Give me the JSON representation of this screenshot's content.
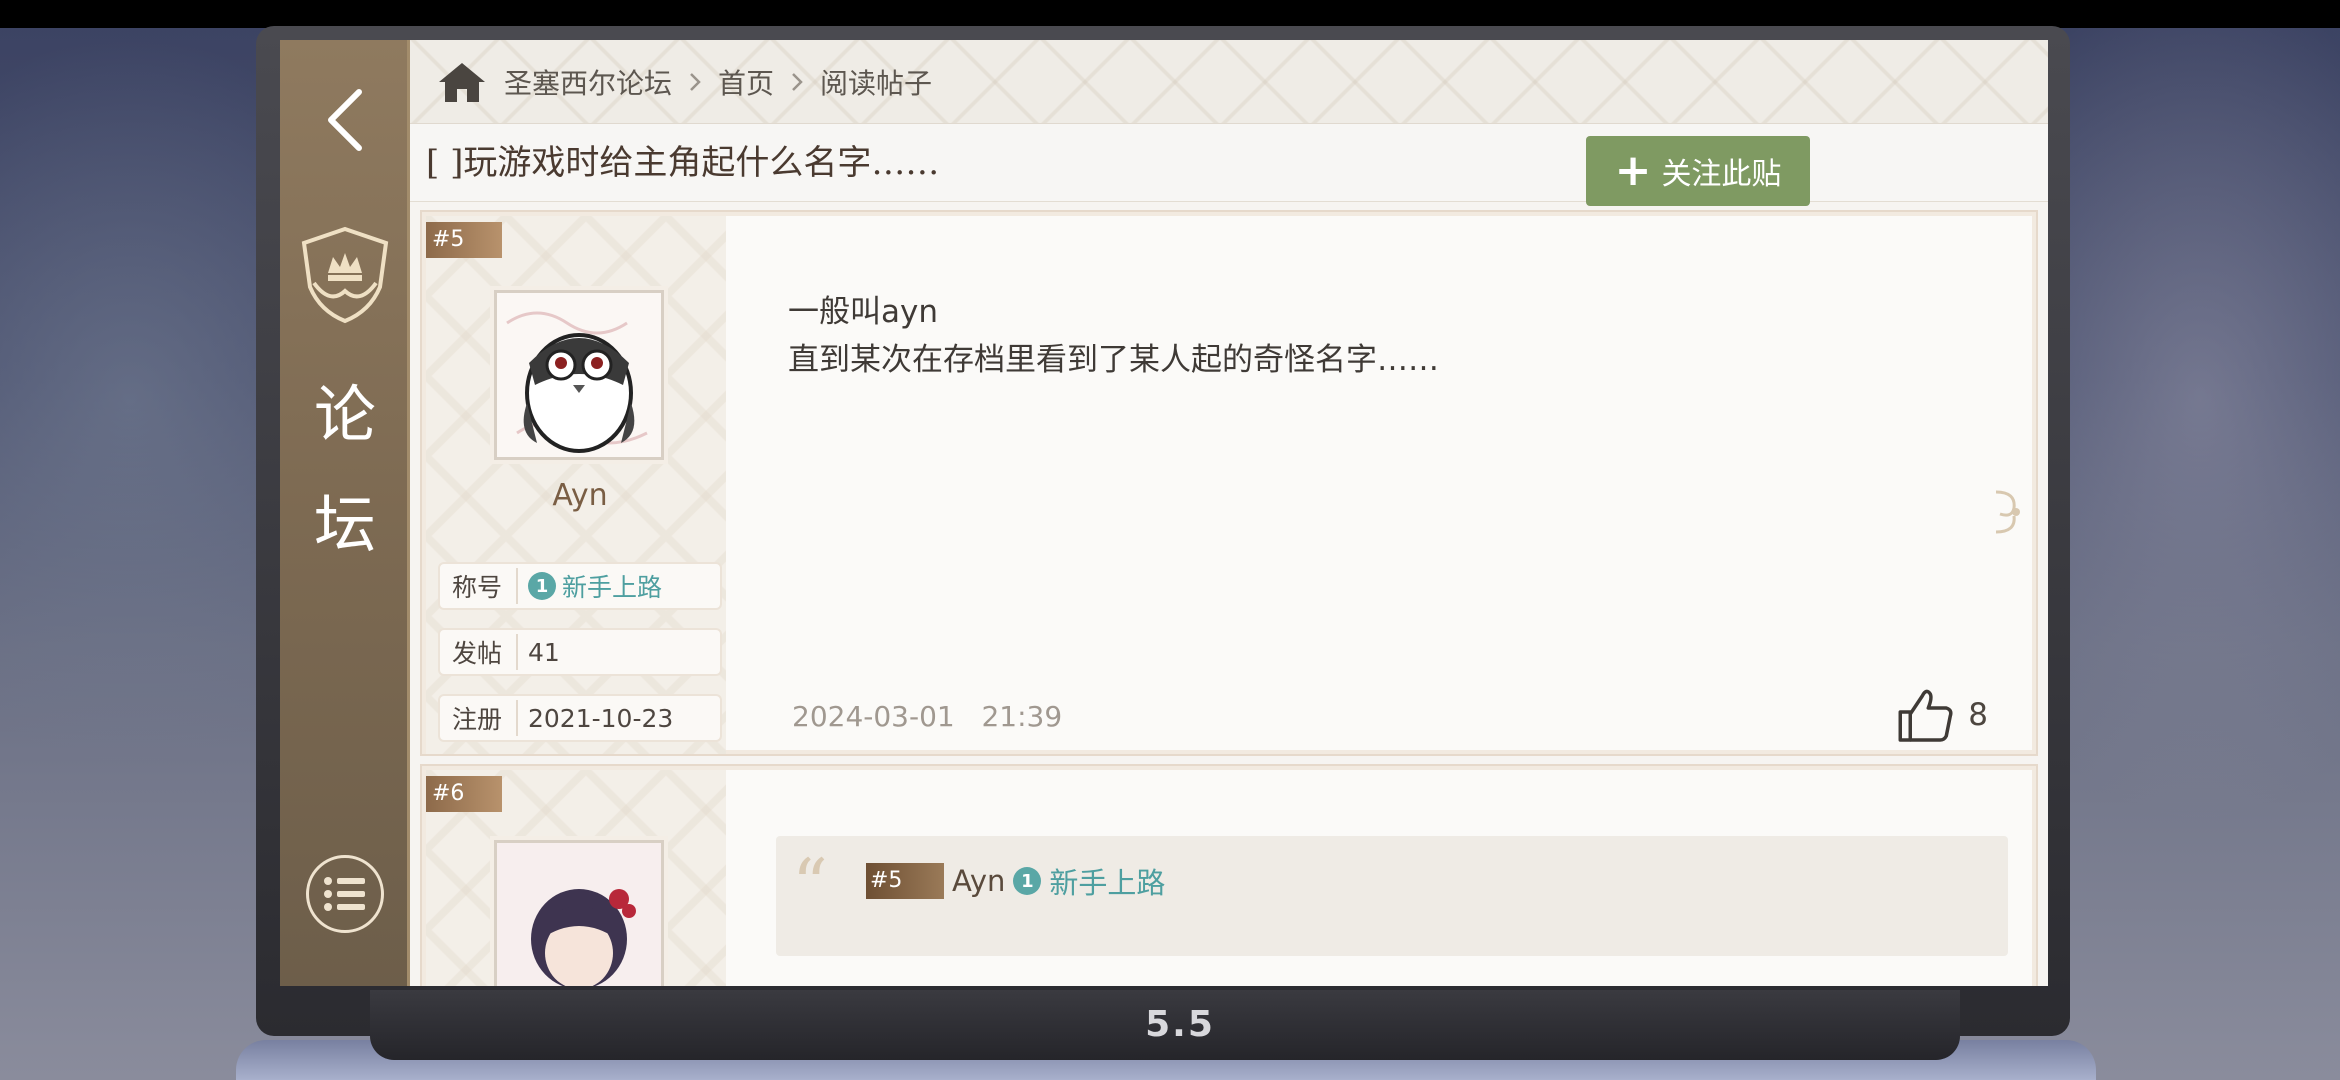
{
  "breadcrumb": {
    "items": [
      "圣塞西尔论坛",
      "首页",
      "阅读帖子"
    ]
  },
  "rail": {
    "title_line1": "论",
    "title_line2": "坛"
  },
  "thread": {
    "title": "[ ]玩游戏时给主角起什么名字……",
    "follow_label": "关注此贴"
  },
  "posts": [
    {
      "floor": "#5",
      "username": "Ayn",
      "stats": [
        {
          "label": "称号",
          "value": "新手上路",
          "badge": "1"
        },
        {
          "label": "发帖",
          "value": "41"
        },
        {
          "label": "注册",
          "value": "2021-10-23"
        }
      ],
      "lines": [
        "一般叫ayn",
        "直到某次在存档里看到了某人起的奇怪名字……"
      ],
      "date": "2024-03-01",
      "time": "21:39",
      "likes": "8"
    },
    {
      "floor": "#6",
      "quote": {
        "floor": "#5",
        "username": "Ayn",
        "badge": "1",
        "title": "新手上路"
      }
    }
  ],
  "brand": "5.5",
  "icons": [
    "back-arrow-icon",
    "academy-emblem-icon",
    "menu-list-icon",
    "home-icon",
    "chevron-right-icon",
    "plus-icon",
    "thumbs-up-icon",
    "quote-icon",
    "ornament-icon"
  ],
  "colors": {
    "rail": "#7d6a52",
    "follow_button": "#7f9a62",
    "badge": "#5aa7a6",
    "floor_tag": "#8d6a4a"
  }
}
